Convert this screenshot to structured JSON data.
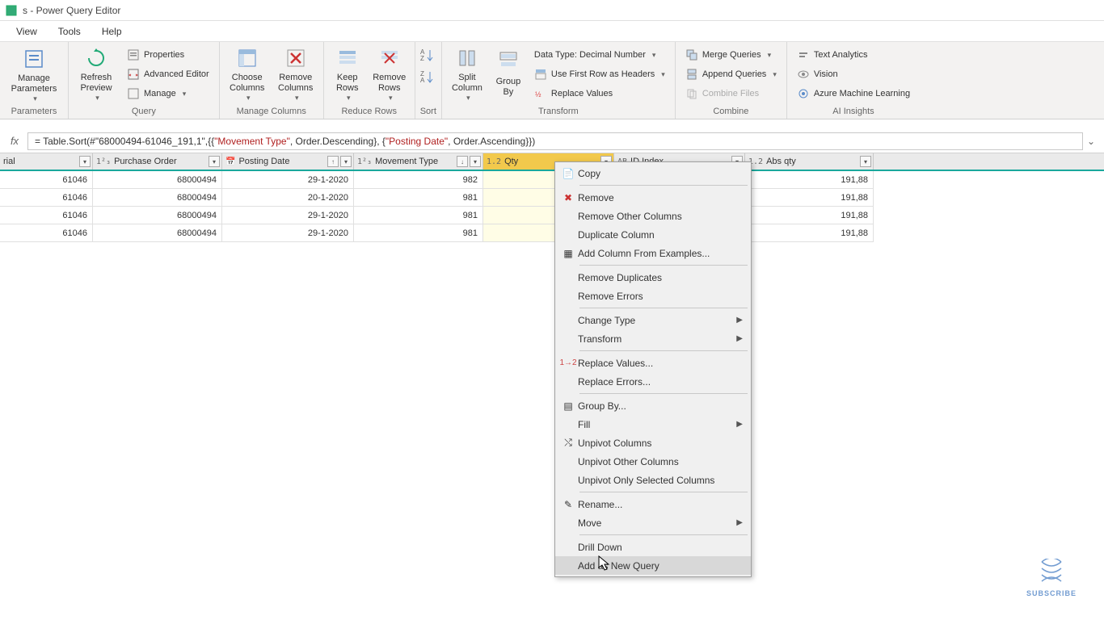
{
  "title": "s - Power Query Editor",
  "menu": {
    "view": "View",
    "tools": "Tools",
    "help": "Help"
  },
  "ribbon": {
    "parameters": {
      "manage": "Manage\nParameters",
      "label": "Parameters"
    },
    "query": {
      "refresh": "Refresh\nPreview",
      "properties": "Properties",
      "advanced": "Advanced Editor",
      "manage": "Manage",
      "label": "Query"
    },
    "manageCols": {
      "choose": "Choose\nColumns",
      "remove": "Remove\nColumns",
      "label": "Manage Columns"
    },
    "reduceRows": {
      "keep": "Keep\nRows",
      "remove": "Remove\nRows",
      "label": "Reduce Rows"
    },
    "sort": {
      "label": "Sort"
    },
    "transform": {
      "split": "Split\nColumn",
      "group": "Group\nBy",
      "datatype": "Data Type: Decimal Number",
      "firstrow": "Use First Row as Headers",
      "replace": "Replace Values",
      "label": "Transform"
    },
    "combine": {
      "merge": "Merge Queries",
      "append": "Append Queries",
      "files": "Combine Files",
      "label": "Combine"
    },
    "ai": {
      "text": "Text Analytics",
      "vision": "Vision",
      "ml": "Azure Machine Learning",
      "label": "AI Insights"
    }
  },
  "formula": {
    "prefix": "= Table.Sort(#\"68000494-61046_191,1\",{{",
    "str1": "\"Movement Type\"",
    "mid1": ", Order.Descending}, {",
    "str2": "\"Posting Date\"",
    "suffix": ", Order.Ascending}})"
  },
  "columns": {
    "material": "rial",
    "po": "Purchase Order",
    "date": "Posting Date",
    "mtype": "Movement Type",
    "qty": "Qty",
    "idx": "ID Index",
    "abs": "Abs qty"
  },
  "rows": [
    {
      "mat": "61046",
      "po": "68000494",
      "date": "29-1-2020",
      "mtype": "982",
      "abs": "191,88"
    },
    {
      "mat": "61046",
      "po": "68000494",
      "date": "20-1-2020",
      "mtype": "981",
      "abs": "191,88"
    },
    {
      "mat": "61046",
      "po": "68000494",
      "date": "29-1-2020",
      "mtype": "981",
      "abs": "191,88"
    },
    {
      "mat": "61046",
      "po": "68000494",
      "date": "29-1-2020",
      "mtype": "981",
      "abs": "191,88"
    }
  ],
  "ctx": {
    "copy": "Copy",
    "remove": "Remove",
    "removeOther": "Remove Other Columns",
    "duplicate": "Duplicate Column",
    "addFrom": "Add Column From Examples...",
    "removeDup": "Remove Duplicates",
    "removeErr": "Remove Errors",
    "changeType": "Change Type",
    "transform": "Transform",
    "replaceVal": "Replace Values...",
    "replaceErr": "Replace Errors...",
    "groupBy": "Group By...",
    "fill": "Fill",
    "unpivot": "Unpivot Columns",
    "unpivotOther": "Unpivot Other Columns",
    "unpivotSel": "Unpivot Only Selected Columns",
    "rename": "Rename...",
    "move": "Move",
    "drill": "Drill Down",
    "addNew": "Add as New Query"
  },
  "subscribe": "SUBSCRIBE"
}
